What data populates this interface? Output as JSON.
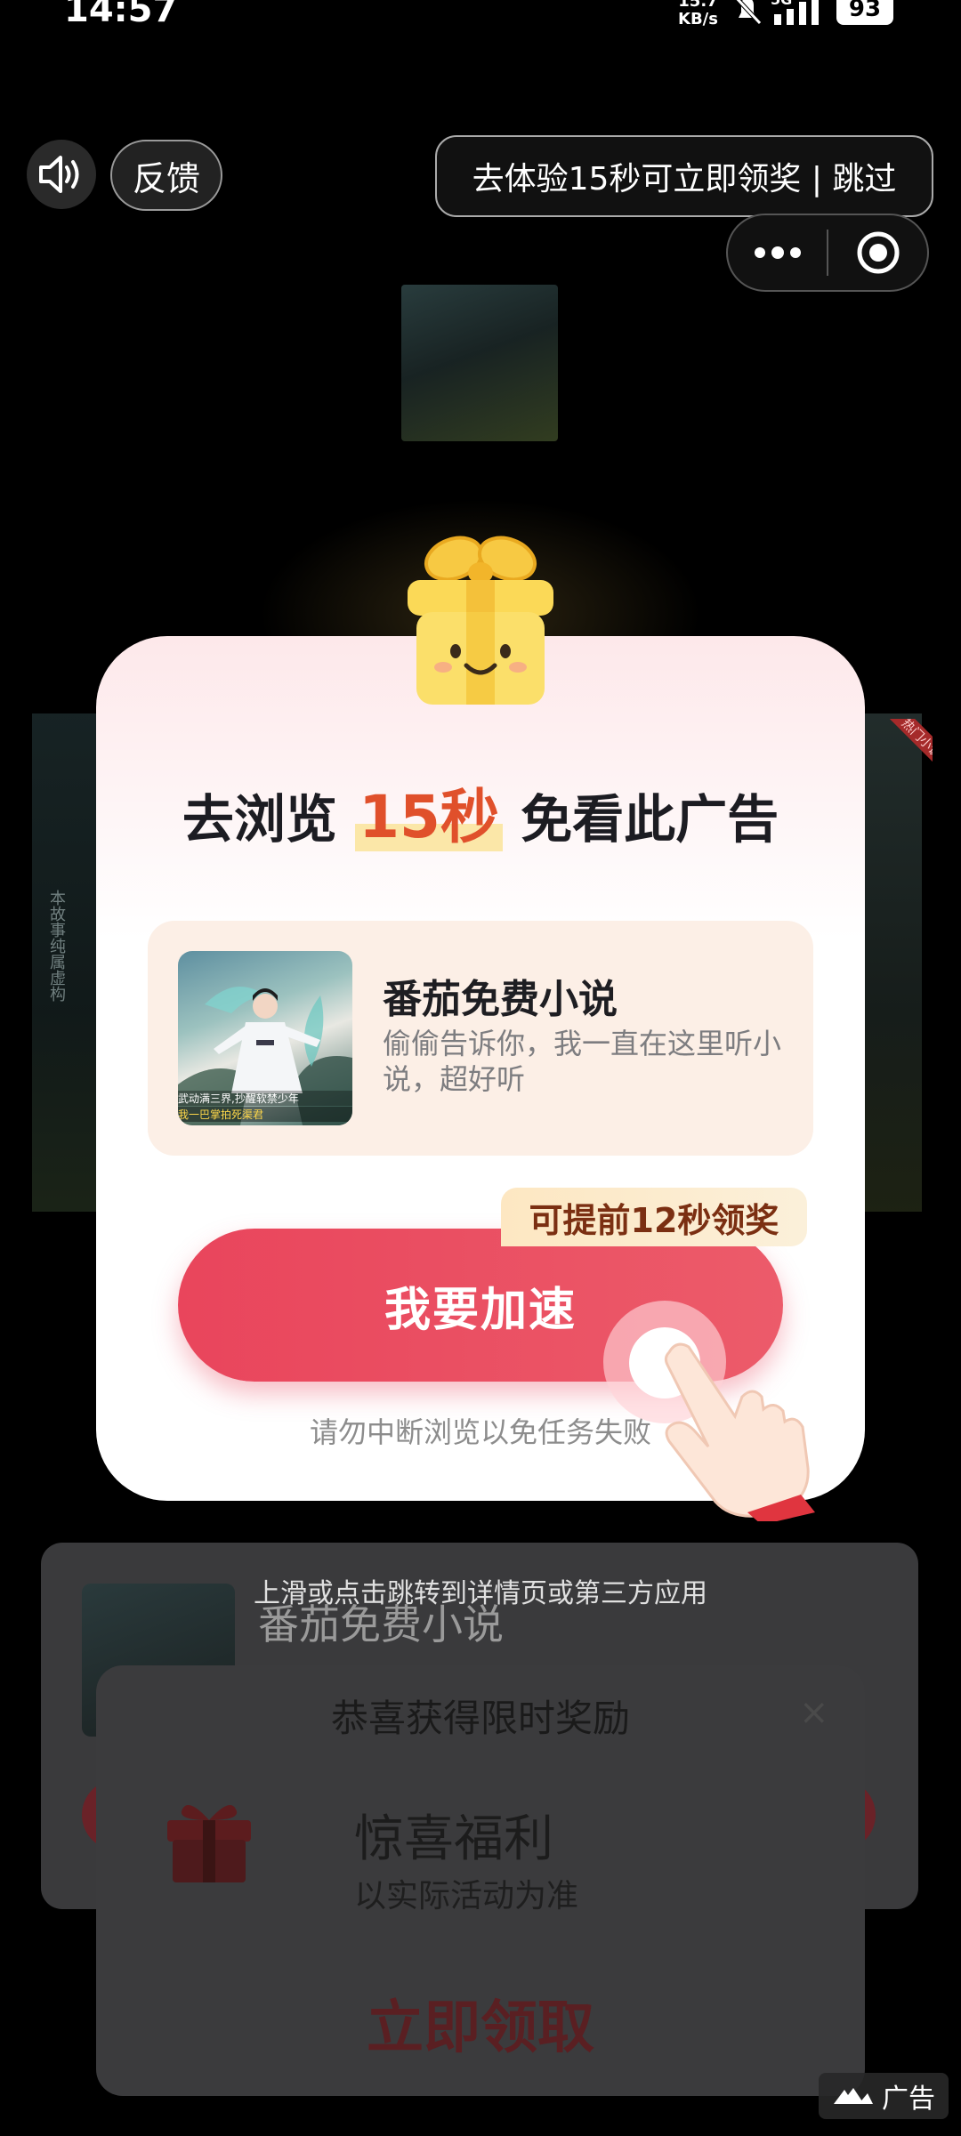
{
  "status_bar": {
    "time": "14:57",
    "net_speed_value": "15.7",
    "net_speed_unit": "KB/s",
    "network": "5G",
    "battery": "93"
  },
  "top_bar": {
    "feedback_label": "反馈",
    "skip_label": "去体验15秒可立即领奖 | 跳过"
  },
  "background": {
    "side_text": "本故事纯属虚构",
    "ribbon_text": "热门小说"
  },
  "card": {
    "title_prefix": "去浏览",
    "title_highlight": "15秒",
    "title_suffix": "免看此广告",
    "app_name": "番茄免费小说",
    "app_desc": "偷偷告诉你，我一直在这里听小说，超好听",
    "app_image_caption_1": "武动满三界,抄醒软禁少年",
    "app_image_caption_2": "我一巴掌拍死渠君",
    "boost_badge": "可提前12秒领奖",
    "boost_button": "我要加速",
    "note": "请勿中断浏览以免任务失败"
  },
  "lower": {
    "swipe_hint": "上滑或点击跳转到详情页或第三方应用",
    "app_title": "番茄免费小说"
  },
  "reward": {
    "heading": "恭喜获得限时奖励",
    "close": "×",
    "title": "惊喜福利",
    "subtitle": "以实际活动为准",
    "cta": "立即领取"
  },
  "ad_tag": "广告"
}
